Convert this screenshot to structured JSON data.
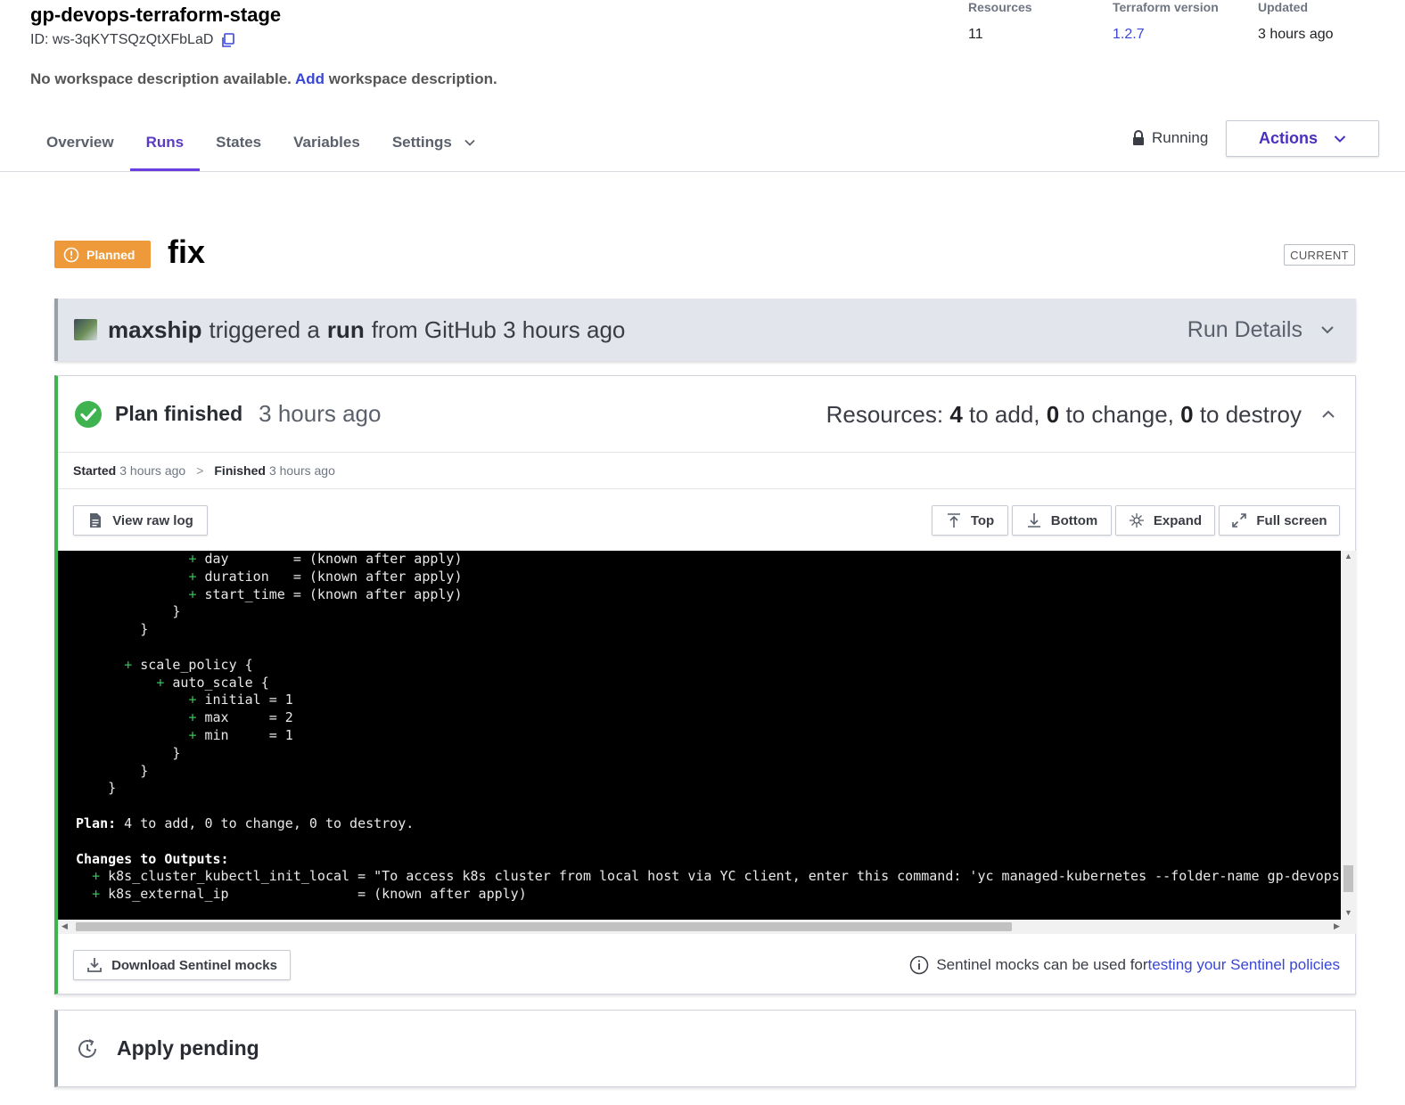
{
  "workspace": {
    "name": "gp-devops-terraform-stage",
    "id": "ID: ws-3qKYTSQzQtXFbLaD",
    "desc_before": "No workspace description available. ",
    "desc_link": "Add",
    "desc_after": " workspace description."
  },
  "meta": {
    "resources_label": "Resources",
    "resources_value": "11",
    "tf_label": "Terraform version",
    "tf_value": "1.2.7",
    "updated_label": "Updated",
    "updated_value": "3 hours ago"
  },
  "tabs": [
    {
      "label": "Overview"
    },
    {
      "label": "Runs"
    },
    {
      "label": "States"
    },
    {
      "label": "Variables"
    },
    {
      "label": "Settings"
    }
  ],
  "status": {
    "label": "Running"
  },
  "actions": {
    "label": "Actions"
  },
  "run": {
    "badge": "Planned",
    "title": "fix",
    "current": "CURRENT"
  },
  "trigger": {
    "user": "maxship",
    "text1": "triggered a",
    "run_word": "run",
    "text2": "from GitHub 3 hours ago",
    "details": "Run Details"
  },
  "plan": {
    "title": "Plan finished",
    "time": "3 hours ago",
    "res_prefix": "Resources: ",
    "add": "4",
    "add_text": " to add, ",
    "change": "0",
    "change_text": " to change, ",
    "destroy": "0",
    "destroy_text": " to destroy",
    "started_label": "Started",
    "started_time": "3 hours ago",
    "sep": ">",
    "finished_label": "Finished",
    "finished_time": "3 hours ago"
  },
  "toolbar": {
    "raw_log": "View raw log",
    "top": "Top",
    "bottom": "Bottom",
    "expand": "Expand",
    "fullscreen": "Full screen"
  },
  "log": [
    {
      "indent": "              ",
      "plus": true,
      "text": "day        = (known after apply)"
    },
    {
      "indent": "              ",
      "plus": true,
      "text": "duration   = (known after apply)"
    },
    {
      "indent": "              ",
      "plus": true,
      "text": "start_time = (known after apply)"
    },
    {
      "indent": "            ",
      "plus": false,
      "text": "}"
    },
    {
      "indent": "        ",
      "plus": false,
      "text": "}"
    },
    {
      "indent": "",
      "plus": false,
      "text": ""
    },
    {
      "indent": "      ",
      "plus": true,
      "text": "scale_policy {"
    },
    {
      "indent": "          ",
      "plus": true,
      "text": "auto_scale {"
    },
    {
      "indent": "              ",
      "plus": true,
      "text": "initial = 1"
    },
    {
      "indent": "              ",
      "plus": true,
      "text": "max     = 2"
    },
    {
      "indent": "              ",
      "plus": true,
      "text": "min     = 1"
    },
    {
      "indent": "            ",
      "plus": false,
      "text": "}"
    },
    {
      "indent": "        ",
      "plus": false,
      "text": "}"
    },
    {
      "indent": "    ",
      "plus": false,
      "text": "}"
    },
    {
      "indent": "",
      "plus": false,
      "text": ""
    },
    {
      "indent": "",
      "plus": false,
      "bold": "Plan:",
      "text": " 4 to add, 0 to change, 0 to destroy."
    },
    {
      "indent": "",
      "plus": false,
      "text": ""
    },
    {
      "indent": "",
      "plus": false,
      "bold": "Changes to Outputs:",
      "text": ""
    },
    {
      "indent": "  ",
      "plus": true,
      "text": "k8s_cluster_kubectl_init_local = \"To access k8s cluster from local host via YC client, enter this command: 'yc managed-kubernetes --folder-name gp-devops"
    },
    {
      "indent": "  ",
      "plus": true,
      "text": "k8s_external_ip                = (known after apply)"
    }
  ],
  "footer": {
    "download": "Download Sentinel mocks",
    "note": "Sentinel mocks can be used for ",
    "note_link": "testing your Sentinel policies"
  },
  "apply": {
    "title": "Apply pending"
  }
}
